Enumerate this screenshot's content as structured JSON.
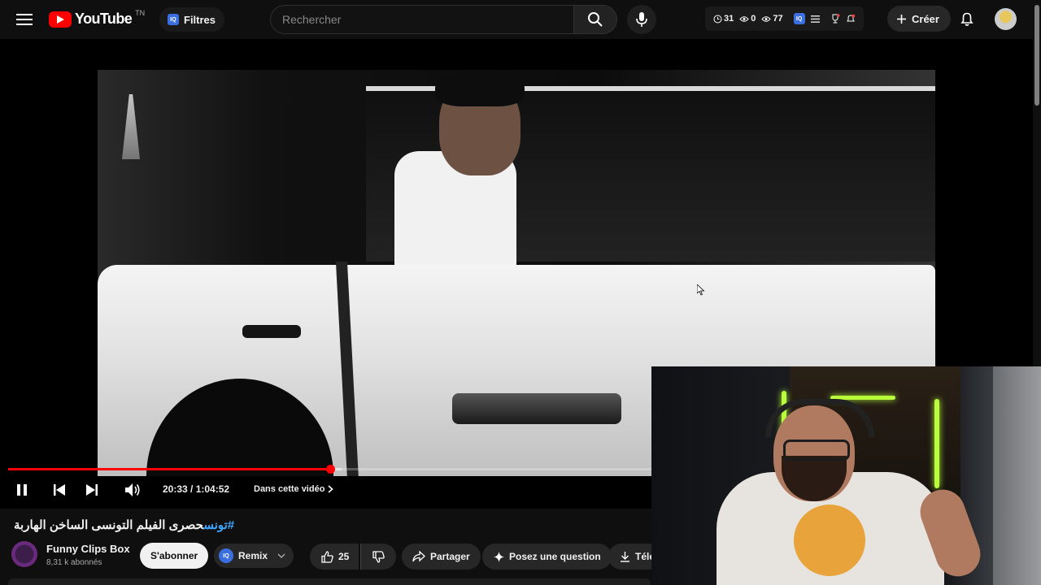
{
  "header": {
    "logo_text": "YouTube",
    "country_code": "TN",
    "filters_badge": "IQ",
    "filters_label": "Filtres",
    "search_placeholder": "Rechercher",
    "stats": {
      "time": "31",
      "views_a": "0",
      "views_b": "77",
      "badge": "IQ"
    },
    "create_label": "Créer"
  },
  "player": {
    "current_time": "20:33",
    "duration": "1:04:52",
    "time_display": "20:33 / 1:04:52",
    "chapter_label": "Dans cette vidéo",
    "progress_fraction": 0.317,
    "state": "playing"
  },
  "video": {
    "title_hashtag": "#تونس",
    "title_text": "حصرى الفيلم التونسى الساخن الهاربة",
    "channel": {
      "name": "Funny Clips Box",
      "subscribers": "8,31 k abonnés",
      "avatar_text": "Funny Clips Box"
    },
    "subscribe_label": "S'abonner",
    "remix_badge": "IQ",
    "remix_label": "Remix",
    "like_count": "25",
    "share_label": "Partager",
    "ask_label": "Posez une question",
    "download_label": "Télé"
  },
  "colors": {
    "background": "#0f0f0f",
    "accent_red": "#ff0000",
    "hashtag_blue": "#3ea6ff",
    "iq_blue": "#3b6fe0"
  }
}
